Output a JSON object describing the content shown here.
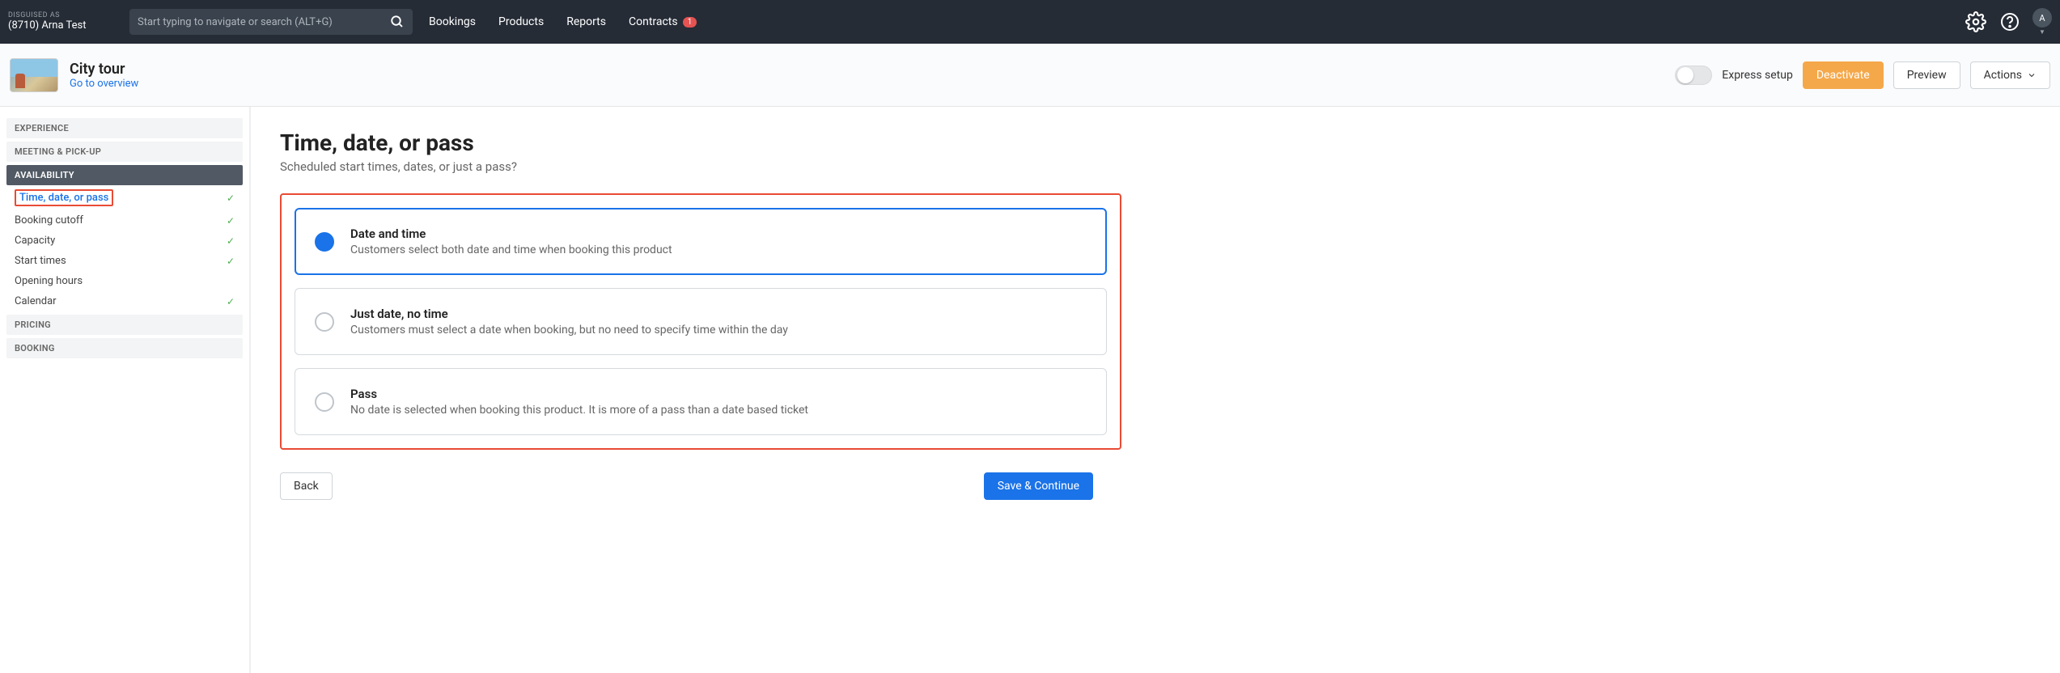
{
  "topnav": {
    "disguise_label": "DISGUISED AS",
    "disguise_name": "(8710) Arna Test",
    "search_placeholder": "Start typing to navigate or search (ALT+G)",
    "links": {
      "bookings": "Bookings",
      "products": "Products",
      "reports": "Reports",
      "contracts": "Contracts",
      "contracts_badge": "1"
    },
    "avatar_letter": "A"
  },
  "secondary": {
    "title": "City tour",
    "overview_link": "Go to overview",
    "express_label": "Express setup",
    "deactivate": "Deactivate",
    "preview": "Preview",
    "actions": "Actions"
  },
  "sidebar": {
    "groups": {
      "experience": "EXPERIENCE",
      "meeting": "MEETING & PICK-UP",
      "availability": "AVAILABILITY",
      "pricing": "PRICING",
      "booking": "BOOKING"
    },
    "items": {
      "time_date_pass": "Time, date, or pass",
      "booking_cutoff": "Booking cutoff",
      "capacity": "Capacity",
      "start_times": "Start times",
      "opening_hours": "Opening hours",
      "calendar": "Calendar"
    }
  },
  "main": {
    "heading": "Time, date, or pass",
    "sub": "Scheduled start times, dates, or just a pass?",
    "options": [
      {
        "title": "Date and time",
        "desc": "Customers select both date and time when booking this product"
      },
      {
        "title": "Just date, no time",
        "desc": "Customers must select a date when booking, but no need to specify time within the day"
      },
      {
        "title": "Pass",
        "desc": "No date is selected when booking this product. It is more of a pass than a date based ticket"
      }
    ],
    "back": "Back",
    "save_continue": "Save & Continue"
  }
}
